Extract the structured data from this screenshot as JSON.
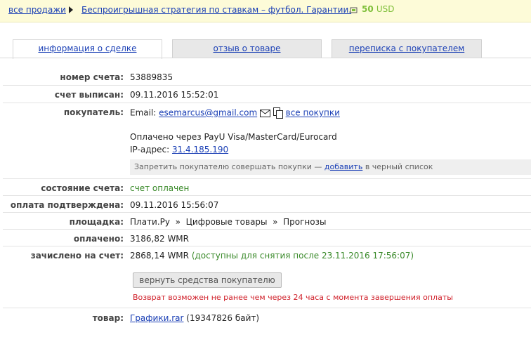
{
  "breadcrumb": {
    "all_sales": "все продажи",
    "product": "Беспроигрышная стратегия по ставкам – футбол. Гарантии.",
    "price_amount": "50",
    "price_currency": "USD"
  },
  "tabs": [
    {
      "label": "информация о сделке",
      "active": true
    },
    {
      "label": "отзыв о товаре",
      "active": false
    },
    {
      "label": "переписка с покупателем",
      "active": false
    }
  ],
  "details": {
    "invoice_number_label": "номер счета:",
    "invoice_number": "53889835",
    "issued_label": "счет выписан:",
    "issued": "09.11.2016 15:52:01",
    "buyer_label": "покупатель:",
    "email_prefix": "Email:",
    "email": "esemarcus@gmail.com",
    "all_purchases": "все покупки",
    "paid_via": "Оплачено через PayU Visa/MasterCard/Eurocard",
    "ip_prefix": "IP-адрес:",
    "ip": "31.4.185.190",
    "blacklist_prefix": "Запретить покупателю совершать покупки —",
    "blacklist_link": "добавить",
    "blacklist_suffix": "в черный список",
    "status_label": "состояние счета:",
    "status": "счет оплачен",
    "confirmed_label": "оплата подтверждена:",
    "confirmed": "09.11.2016 15:56:07",
    "platform_label": "площадка:",
    "platform": "Плати.Ру  »  Цифровые товары  »  Прогнозы",
    "paid_label": "оплачено:",
    "paid": "3186,82 WMR",
    "credited_label": "зачислено на счет:",
    "credited": "2868,14 WMR",
    "credited_note": "(доступны для снятия после 23.11.2016 17:56:07)",
    "refund_button": "вернуть средства покупателю",
    "refund_note": "Возврат возможен не ранее чем через 24 часа с момента завершения оплаты",
    "product_label": "товар:",
    "file_name": "Графики.rar",
    "file_size": "(19347826 байт)"
  },
  "colors": {
    "topbar_bg": "#fdfbd8",
    "link": "#1a3fb5",
    "status_green": "#3a8a2a",
    "warning_red": "#d0202a"
  }
}
